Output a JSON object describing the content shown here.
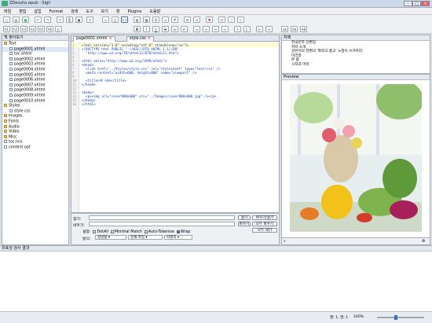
{
  "window": {
    "title": "ZDesuho.epub - Sigil"
  },
  "menu": [
    "파일",
    "편집",
    "삽입",
    "Format",
    "검색",
    "도구",
    "보기",
    "창",
    "Plugins",
    "도움말"
  ],
  "toolbar2": {
    "headings": [
      "h1",
      "h2",
      "h3",
      "h4",
      "h5",
      "h6",
      "p"
    ],
    "case": [
      "ab",
      "Ab",
      "AB"
    ]
  },
  "book_browser": {
    "title": "책 찾아보기",
    "items": [
      {
        "label": "Text",
        "kind": "folder",
        "level": 0
      },
      {
        "label": "page0001.xhtml",
        "kind": "file",
        "level": 1,
        "selected": true
      },
      {
        "label": "toc.xhtml",
        "kind": "file",
        "level": 1
      },
      {
        "label": "page0002.xhtml",
        "kind": "file",
        "level": 1
      },
      {
        "label": "page0003.xhtml",
        "kind": "file",
        "level": 1
      },
      {
        "label": "page0004.xhtml",
        "kind": "file",
        "level": 1
      },
      {
        "label": "page0005.xhtml",
        "kind": "file",
        "level": 1
      },
      {
        "label": "page0006.xhtml",
        "kind": "file",
        "level": 1
      },
      {
        "label": "page0007.xhtml",
        "kind": "file",
        "level": 1
      },
      {
        "label": "page0008.xhtml",
        "kind": "file",
        "level": 1
      },
      {
        "label": "page0009.xhtml",
        "kind": "file",
        "level": 1
      },
      {
        "label": "page0010.xhtml",
        "kind": "file",
        "level": 1
      },
      {
        "label": "Styles",
        "kind": "folder",
        "level": 0
      },
      {
        "label": "style.css",
        "kind": "file",
        "level": 1
      },
      {
        "label": "Images",
        "kind": "folder",
        "level": 0
      },
      {
        "label": "Fonts",
        "kind": "folder",
        "level": 0
      },
      {
        "label": "Audio",
        "kind": "folder",
        "level": 0
      },
      {
        "label": "Video",
        "kind": "folder",
        "level": 0
      },
      {
        "label": "Misc",
        "kind": "folder",
        "level": 0
      },
      {
        "label": "toc.ncx",
        "kind": "file",
        "level": 0
      },
      {
        "label": "content.opf",
        "kind": "file",
        "level": 0
      }
    ]
  },
  "tabs": [
    {
      "label": "page0001.xhtml",
      "active": true
    },
    {
      "label": "style.css",
      "active": false
    }
  ],
  "code_lines": [
    "<?xml version=\"1.0\" encoding=\"utf-8\" standalone=\"no\"?>",
    "<!DOCTYPE html PUBLIC \"-//W3C//DTD XHTML 1.1//EN\"",
    "  \"http://www.w3.org/TR/xhtml11/DTD/xhtml11.dtd\">",
    "",
    "<html xmlns=\"http://www.w3.org/1999/xhtml\">",
    "<head>",
    "  <link href=\"../Styles/style.css\" rel=\"stylesheet\" type=\"text/css\" />",
    "  <meta content=\"width=600, height=800\" name=\"viewport\" />",
    "",
    "  <title>책 커버</title>",
    "</head>",
    "",
    "<body>",
    "  <p><img alt=\"cover800x600\" src=\"../Images/cover800x600.jpg\" /></p>",
    "</body>",
    "</html>"
  ],
  "find": {
    "find_label": "찾기:",
    "replace_label": "바꾸기:",
    "find_btn": "찾기",
    "replace_find_btn": "바꾸기/찾기",
    "replace_btn": "바꾸기",
    "replace_all_btn": "모두 바꾸기",
    "count_btn": "모두 세기",
    "mode_label": "설정:",
    "options": [
      {
        "label": "DotAll",
        "on": false
      },
      {
        "label": "Minimal Match",
        "on": false
      },
      {
        "label": "Auto-Tokenise",
        "on": false
      },
      {
        "label": "Wrap",
        "on": true
      }
    ],
    "scope_label": "방식:",
    "mode_value": "정방향",
    "target_value": "현재 파일",
    "direction_value": "아래쪽"
  },
  "toc": {
    "title": "차례",
    "items": [
      "한국문학 단편집",
      "저자 소개",
      "글쓴이의 한편의 '화약고 품고' 노칠이 쓰겨하라.",
      "머리말",
      "본 몸",
      "시작과 머리"
    ]
  },
  "preview": {
    "title": "Preview"
  },
  "validation": {
    "title": "유효성 검사 결과"
  },
  "status": {
    "position": "행: 1, 열: 1",
    "zoom": "100%"
  },
  "colors": {
    "accent": "#3b6fc4",
    "tag": "#1740b8"
  }
}
